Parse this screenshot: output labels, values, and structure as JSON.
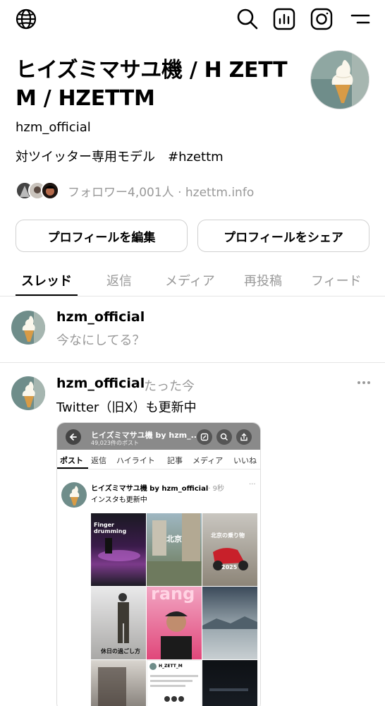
{
  "header": {
    "icons": [
      "globe-icon",
      "search-icon",
      "insights-icon",
      "instagram-icon",
      "menu-icon"
    ]
  },
  "profile": {
    "name_line1": "ヒイズミマサユ機 / H ZETT",
    "name_line2": "M / HZETTM",
    "handle": "hzm_official",
    "bio": "対ツイッター専用モデル　#hzettm",
    "followers_text": "フォロワー4,001人 · hzettm.info"
  },
  "buttons": {
    "edit_profile": "プロフィールを編集",
    "share_profile": "プロフィールをシェア"
  },
  "tabs": [
    "スレッド",
    "返信",
    "メディア",
    "再投稿",
    "フィード"
  ],
  "compose": {
    "username": "hzm_official",
    "placeholder": "今なにしてる？"
  },
  "post": {
    "username": "hzm_official",
    "time": "たった今",
    "text": "Twitter（旧X）も更新中",
    "screenshot": {
      "title": "ヒイズミマサユ機 by hzm_...",
      "subtitle": "49,023件のポスト",
      "tabs": [
        "ポスト",
        "返信",
        "ハイライト",
        "記事",
        "メディア",
        "いいね"
      ],
      "inner_name": "ヒイズミマサユ機 by hzm_official",
      "inner_time": "· 9秒",
      "inner_text": "インスタも更新中",
      "grid_labels": {
        "c1": "Finger drumming",
        "c2": "北京",
        "c3": "北京の乗り物",
        "c3b": "2025",
        "c4": "休日の過ごし方",
        "c5": "rang",
        "c8": "H_ZETT_M"
      }
    }
  }
}
